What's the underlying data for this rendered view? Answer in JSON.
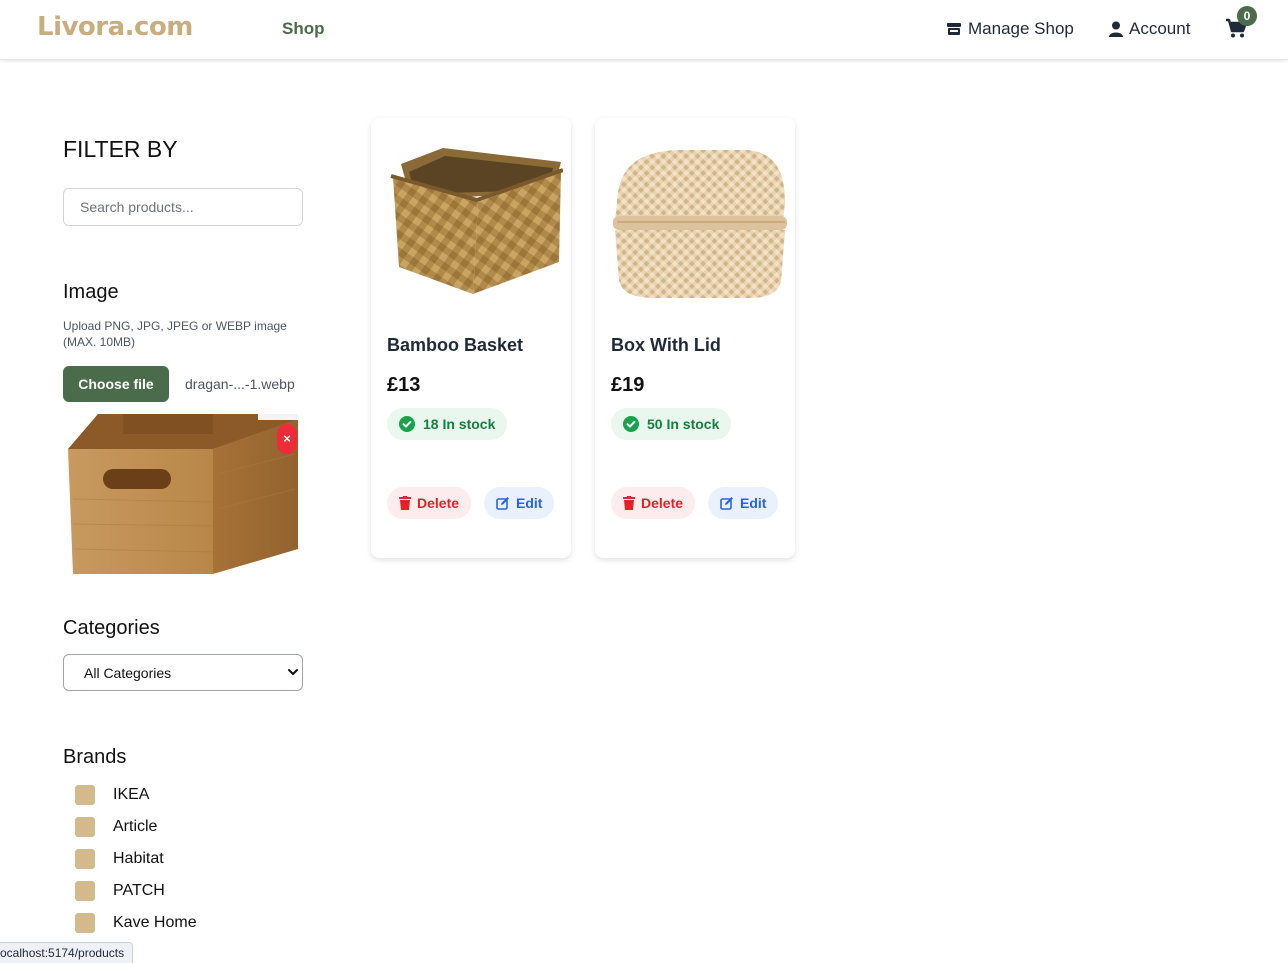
{
  "header": {
    "logo": "Livora.com",
    "nav_shop": "Shop",
    "manage_shop": "Manage Shop",
    "account": "Account",
    "cart_count": "0"
  },
  "sidebar": {
    "filter_title": "FILTER BY",
    "search_placeholder": "Search products...",
    "image_title": "Image",
    "image_help": "Upload PNG, JPG, JPEG or WEBP image (MAX. 10MB)",
    "choose_file": "Choose file",
    "file_name": "dragan-...-1.webp",
    "remove_label": "×",
    "categories_title": "Categories",
    "categories_selected": "All Categories",
    "brands_title": "Brands",
    "brands": [
      "IKEA",
      "Article",
      "Habitat",
      "PATCH",
      "Kave Home"
    ]
  },
  "products": [
    {
      "name": "Bamboo Basket",
      "price": "£13",
      "stock": "18 In stock",
      "delete": "Delete",
      "edit": "Edit"
    },
    {
      "name": "Box With Lid",
      "price": "£19",
      "stock": "50 In stock",
      "delete": "Delete",
      "edit": "Edit"
    }
  ],
  "status_bar": "ocalhost:5174/products",
  "colors": {
    "brand": "#c8ad7f",
    "primary": "#4a6c4a",
    "danger": "#dc2626",
    "info": "#2563eb",
    "success": "#15803d"
  }
}
